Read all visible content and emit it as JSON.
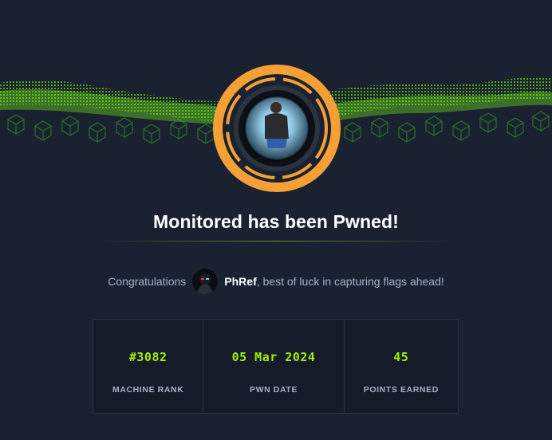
{
  "header": {
    "title": "Monitored has been Pwned!"
  },
  "congrats": {
    "prefix": "Congratulations",
    "username": "PhRef",
    "suffix": ", best of luck in capturing flags ahead!"
  },
  "stats": [
    {
      "value": "#3082",
      "label": "MACHINE RANK"
    },
    {
      "value": "05 Mar 2024",
      "label": "PWN DATE"
    },
    {
      "value": "45",
      "label": "POINTS EARNED"
    }
  ],
  "icons": {
    "banner": "green-cube-grid-wave",
    "badge": "machine-avatar-icon",
    "user_avatar": "user-avatar-icon"
  },
  "colors": {
    "background": "#1a2231",
    "accent_green": "#9fef00",
    "badge_ring": "#f5a034",
    "muted_text": "#a4b1cd"
  }
}
